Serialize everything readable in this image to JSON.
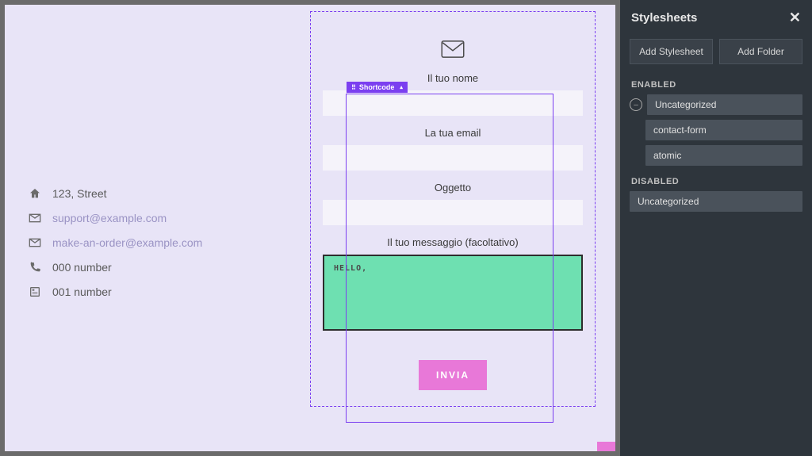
{
  "canvas": {
    "info": {
      "address": "123, Street",
      "support_email": "support@example.com",
      "order_email": "make-an-order@example.com",
      "phone1": "000 number",
      "phone2": "001 number"
    },
    "form": {
      "badge_label": "Shortcode",
      "name_label": "Il tuo nome",
      "email_label": "La tua email",
      "subject_label": "Oggetto",
      "message_label": "Il tuo messaggio (facoltativo)",
      "message_value": "HELLO,",
      "submit_label": "INVIA"
    }
  },
  "sidebar": {
    "title": "Stylesheets",
    "add_stylesheet": "Add Stylesheet",
    "add_folder": "Add Folder",
    "enabled_label": "ENABLED",
    "disabled_label": "DISABLED",
    "enabled": {
      "folder": "Uncategorized",
      "children": [
        "contact-form",
        "atomic"
      ]
    },
    "disabled": {
      "folder": "Uncategorized"
    }
  }
}
